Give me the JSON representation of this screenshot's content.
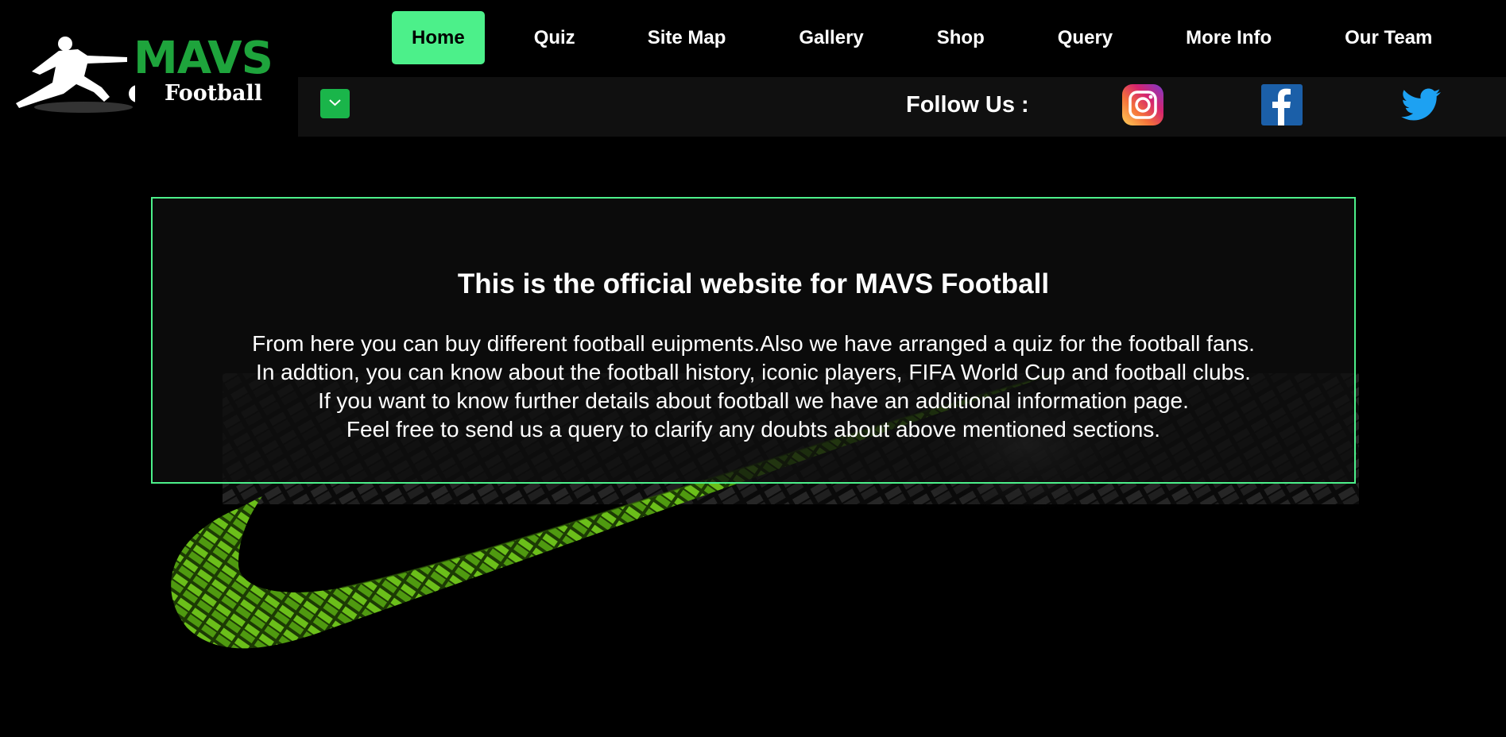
{
  "logo": {
    "brand": "MAVS",
    "subtitle": "Football",
    "icon": "football-player-kicking-icon"
  },
  "nav": {
    "items": [
      {
        "label": "Home",
        "active": true
      },
      {
        "label": "Quiz",
        "active": false
      },
      {
        "label": "Site Map",
        "active": false
      },
      {
        "label": "Gallery",
        "active": false
      },
      {
        "label": "Shop",
        "active": false
      },
      {
        "label": "Query",
        "active": false
      },
      {
        "label": "More Info",
        "active": false
      },
      {
        "label": "Our Team",
        "active": false
      }
    ]
  },
  "subbar": {
    "menu_toggle_icon": "chevron-down-icon",
    "follow_label": "Follow Us :",
    "social": [
      {
        "name": "instagram-icon"
      },
      {
        "name": "facebook-icon"
      },
      {
        "name": "twitter-icon"
      }
    ]
  },
  "intro": {
    "title": "This is the official website for MAVS Football",
    "lines": [
      "From here you can buy different football euipments.Also we have arranged a quiz for the football fans.",
      "In addtion, you can know about the football history, iconic players, FIFA World Cup and football clubs.",
      "If you want to know further details about football we have an additional information page.",
      "Feel free to send us a query to clarify any doubts about above mentioned sections."
    ]
  },
  "colors": {
    "accent": "#4cf08a",
    "brand_green": "#1ea43c",
    "background": "#000000",
    "subbar": "#101010",
    "swoosh": "#5fae12"
  }
}
